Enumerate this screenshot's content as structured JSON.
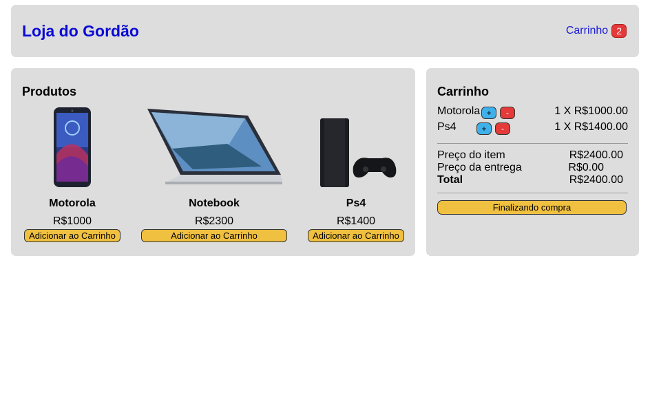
{
  "header": {
    "brand": "Loja do Gordão",
    "cart_label": "Carrinho",
    "cart_count": "2"
  },
  "products": {
    "title": "Produtos",
    "items": [
      {
        "name": "Motorola",
        "price": "R$1000",
        "button": "Adicionar ao Carrinho",
        "icon": "phone-image"
      },
      {
        "name": "Notebook",
        "price": "R$2300",
        "button": "Adicionar ao Carrinho",
        "icon": "laptop-image"
      },
      {
        "name": "Ps4",
        "price": "R$1400",
        "button": "Adicionar ao Carrinho",
        "icon": "console-image"
      }
    ]
  },
  "cart": {
    "title": "Carrinho",
    "items": [
      {
        "name": "Motorola",
        "plus": "+",
        "minus": "-",
        "qty_line": "1 X R$1000.00"
      },
      {
        "name": "Ps4",
        "plus": "+",
        "minus": "-",
        "qty_line": "1 X R$1400.00"
      }
    ],
    "summary": {
      "item_price_label": "Preço do item",
      "item_price_value": "R$2400.00",
      "shipping_label": "Preço da entrega",
      "shipping_value": "R$0.00",
      "total_label": "Total",
      "total_value": "R$2400.00"
    },
    "checkout_label": "Finalizando compra"
  },
  "colors": {
    "brand": "#0a0ad6",
    "panel_bg": "#dddddd",
    "button_yellow": "#f0c040",
    "badge_red": "#e53a3a",
    "plus_blue": "#3fb1ea"
  }
}
